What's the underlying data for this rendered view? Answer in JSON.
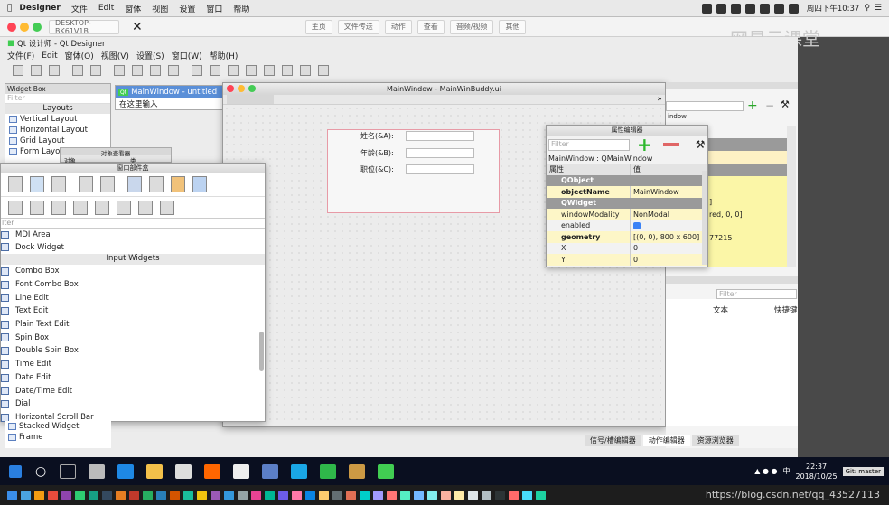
{
  "menubar": {
    "app": "Designer",
    "items": [
      "文件",
      "Edit",
      "窗体",
      "视图",
      "设置",
      "窗口",
      "帮助"
    ],
    "clock": "周四下午10:37"
  },
  "remote": {
    "host": "DESKTOP-BK61V1B",
    "buttons": [
      "主页",
      "文件传送",
      "动作",
      "查看",
      "音频/视频",
      "其他"
    ]
  },
  "watermark": {
    "text": "网易云课堂"
  },
  "qd": {
    "title": "Qt 设计师 - Qt Designer",
    "menu": [
      "文件(F)",
      "Edit",
      "窗体(O)",
      "视图(V)",
      "设置(S)",
      "窗口(W)",
      "帮助(H)"
    ]
  },
  "widget_box": {
    "title": "Widget Box",
    "filter": "Filter",
    "category": "Layouts",
    "items": [
      "Vertical Layout",
      "Horizontal Layout",
      "Grid Layout",
      "Form Layout"
    ]
  },
  "object_inspector": {
    "title": "对象查看器",
    "col1": "对象",
    "col2": "类"
  },
  "subwin": {
    "title": "MainWindow - untitled",
    "hint": "在这里输入"
  },
  "designer": {
    "title": "MainWindow - MainWinBuddy.ui"
  },
  "form": {
    "labels": [
      "姓名(&A):",
      "年龄(&B):",
      "职位(&C):"
    ]
  },
  "prop_editor": {
    "title": "属性编辑器",
    "filter": "Filter",
    "object": "MainWindow : QMainWindow",
    "col_prop": "属性",
    "col_val": "值",
    "rows": [
      {
        "k": "QObject",
        "v": "",
        "cat": true
      },
      {
        "k": "objectName",
        "v": "MainWindow",
        "bold": true
      },
      {
        "k": "QWidget",
        "v": "",
        "cat": true
      },
      {
        "k": "windowModality",
        "v": "NonModal"
      },
      {
        "k": "enabled",
        "v": ""
      },
      {
        "k": "geometry",
        "v": "[(0, 0), 800 x 600]",
        "bold": true
      },
      {
        "k": "X",
        "v": "0"
      },
      {
        "k": "Y",
        "v": "0"
      }
    ]
  },
  "widget_panel": {
    "title": "窗口部件盒",
    "filter": "lter",
    "top_items": [
      "MDI Area",
      "Dock Widget"
    ],
    "section": "Input Widgets",
    "items": [
      "Combo Box",
      "Font Combo Box",
      "Line Edit",
      "Text Edit",
      "Plain Text Edit",
      "Spin Box",
      "Double Spin Box",
      "Time Edit",
      "Date Edit",
      "Date/Time Edit",
      "Dial",
      "Horizontal Scroll Bar"
    ]
  },
  "right_panel": {
    "filter": "Filter",
    "col_text": "文本",
    "col_shortcut": "快捷键",
    "partial": [
      "indow",
      "]",
      "red, 0, 0]",
      "77215"
    ],
    "tabs": [
      "信号/槽编辑器",
      "动作编辑器",
      "资源浏览器"
    ]
  },
  "bottom_left": {
    "items": [
      "Stacked Widget",
      "Frame"
    ]
  },
  "taskbar": {
    "time": "22:37",
    "date": "2018/10/25",
    "ime": "中",
    "git": "Git: master"
  },
  "dock": {
    "url_watermark": "https://blog.csdn.net/qq_43527113"
  }
}
